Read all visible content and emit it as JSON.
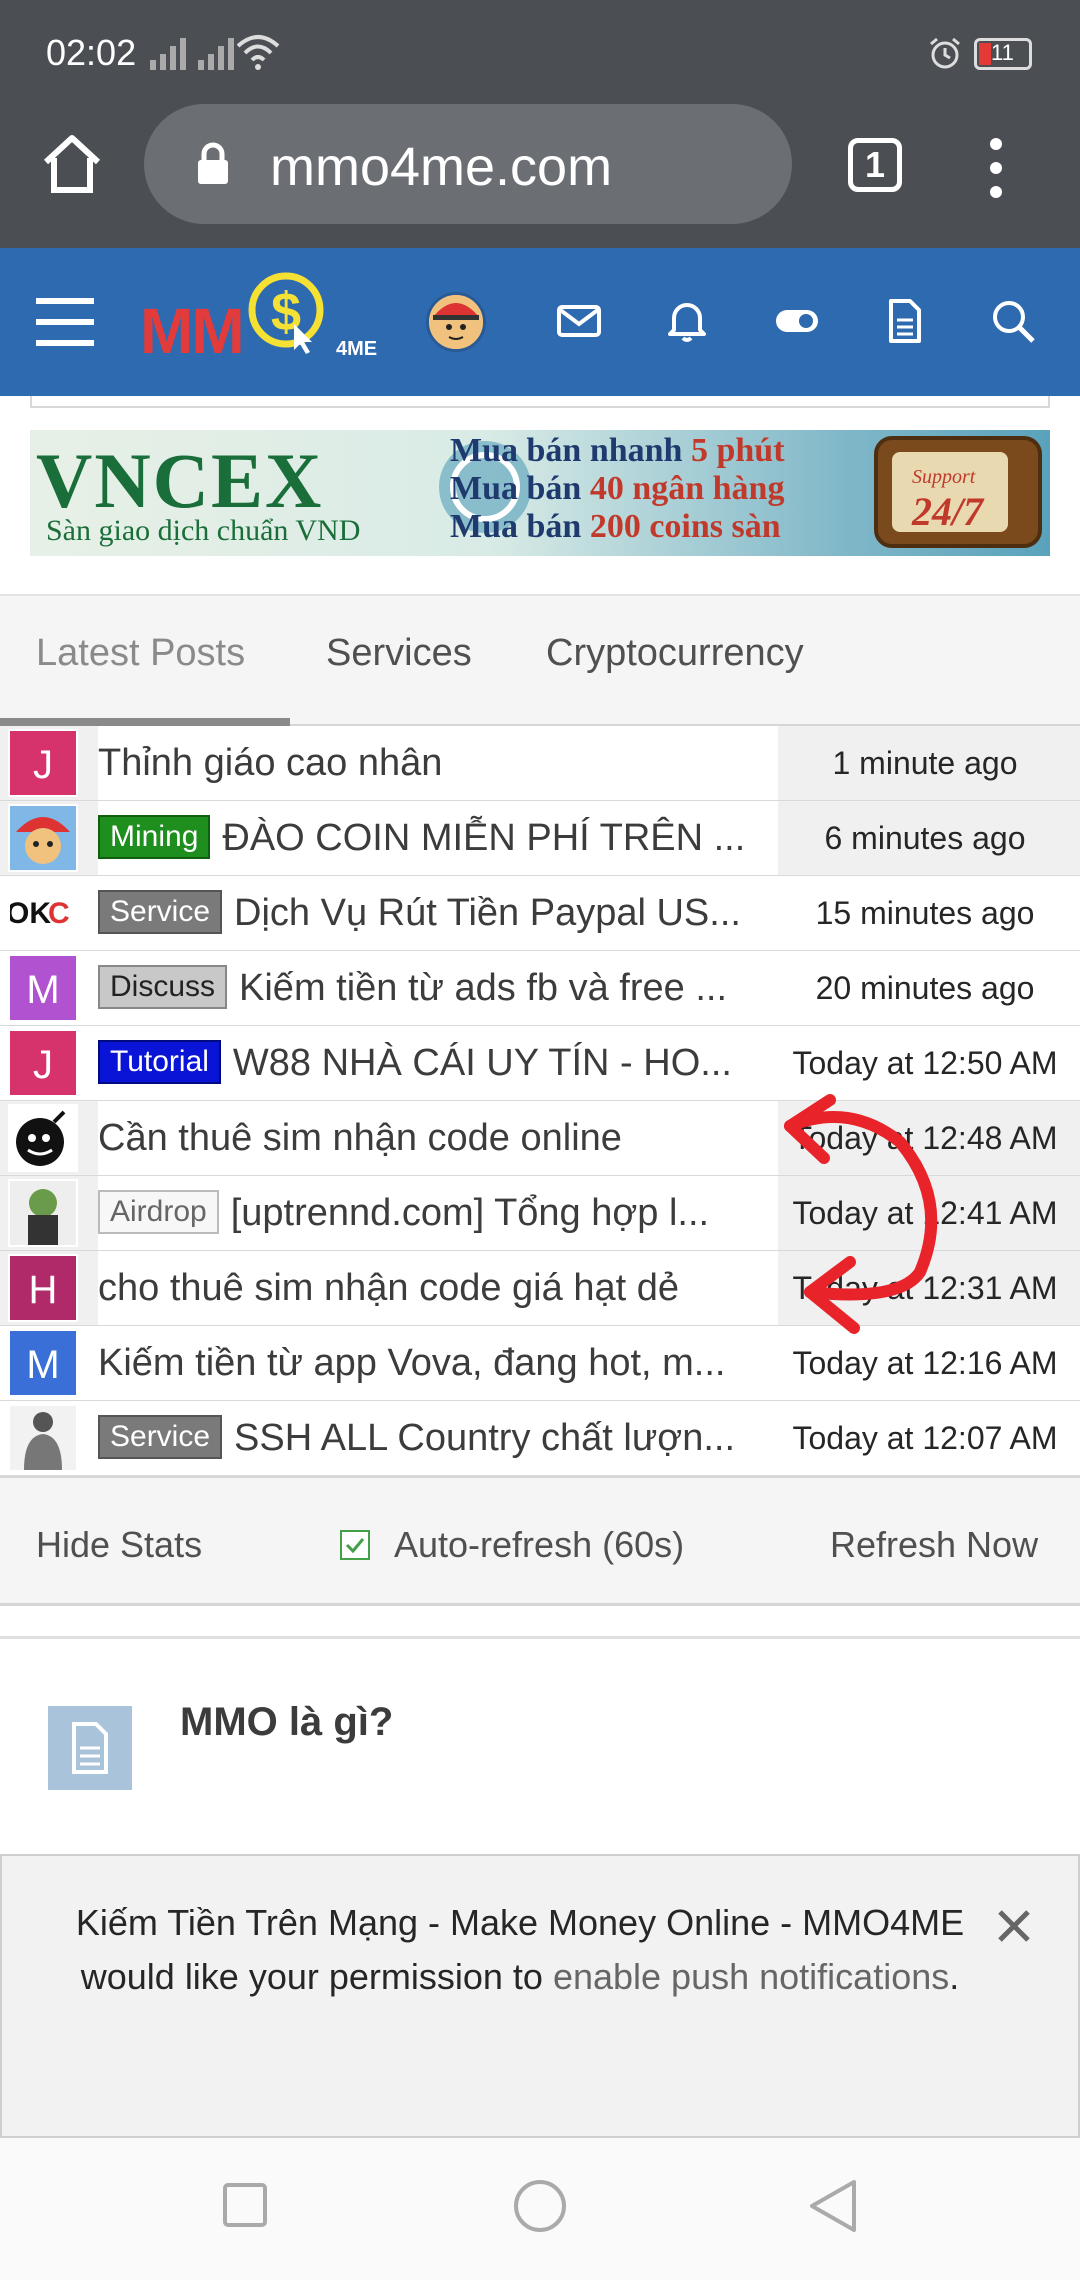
{
  "status_bar": {
    "time": "02:02",
    "battery": "11"
  },
  "browser": {
    "url": "mmo4me.com",
    "tab_count": "1"
  },
  "header": {
    "logo_text": "MM",
    "logo_sub": "4ME"
  },
  "banner": {
    "title": "VNCEX",
    "subtitle": "Sàn giao dịch chuẩn VND",
    "line1_a": "Mua bán nhanh ",
    "line1_b": "5 phút",
    "line2_a": "Mua bán ",
    "line2_b": "40 ngân hàng",
    "line3_a": "Mua bán ",
    "line3_b": "200 coins sàn",
    "support": "Support",
    "hours": "24/7"
  },
  "tabs": [
    {
      "label": "Latest Posts"
    },
    {
      "label": "Services"
    },
    {
      "label": "Cryptocurrency"
    }
  ],
  "posts": [
    {
      "avatar": "J",
      "prefix": "",
      "title": "Thỉnh giáo cao nhân",
      "time": "1 minute ago"
    },
    {
      "avatar": "",
      "prefix": "Mining",
      "title": "ĐÀO COIN MIỄN PHÍ TRÊN ...",
      "time": "6 minutes ago"
    },
    {
      "avatar": "",
      "prefix": "Service",
      "title": "Dịch Vụ Rút Tiền Paypal US...",
      "time": "15 minutes ago"
    },
    {
      "avatar": "M",
      "prefix": "Discuss",
      "title": "Kiếm tiền từ ads fb và free ...",
      "time": "20 minutes ago"
    },
    {
      "avatar": "J",
      "prefix": "Tutorial",
      "title": "W88 NHÀ CÁI UY TÍN - HO...",
      "time": "Today at 12:50 AM"
    },
    {
      "avatar": "",
      "prefix": "",
      "title": "Cần thuê sim nhận code online",
      "time": "Today at 12:48 AM"
    },
    {
      "avatar": "",
      "prefix": "Airdrop",
      "title": "[uptrennd.com] Tổng hợp l...",
      "time": "Today at 12:41 AM"
    },
    {
      "avatar": "H",
      "prefix": "",
      "title": "cho thuê sim nhận code giá hạt dẻ",
      "time": "Today at 12:31 AM"
    },
    {
      "avatar": "M",
      "prefix": "",
      "title": "Kiếm tiền từ app Vova, đang hot, m...",
      "time": "Today at 12:16 AM"
    },
    {
      "avatar": "",
      "prefix": "Service",
      "title": "SSH ALL Country chất lượn...",
      "time": "Today at 12:07 AM"
    }
  ],
  "stats_bar": {
    "hide_stats": "Hide Stats",
    "auto_refresh": "Auto-refresh (60s)",
    "refresh_now": "Refresh Now"
  },
  "section": {
    "title": "MMO là gì?"
  },
  "push_prompt": {
    "text": "Kiếm Tiền Trên Mạng - Make Money Online - MMO4ME would like your permission to ",
    "link": "enable push notifications",
    "end": "."
  },
  "colors": {
    "header_blue": "#2d6ab0",
    "chrome_gray": "#4b4f54",
    "mining": "#1e8e1e",
    "tutorial": "#0a14d6"
  }
}
